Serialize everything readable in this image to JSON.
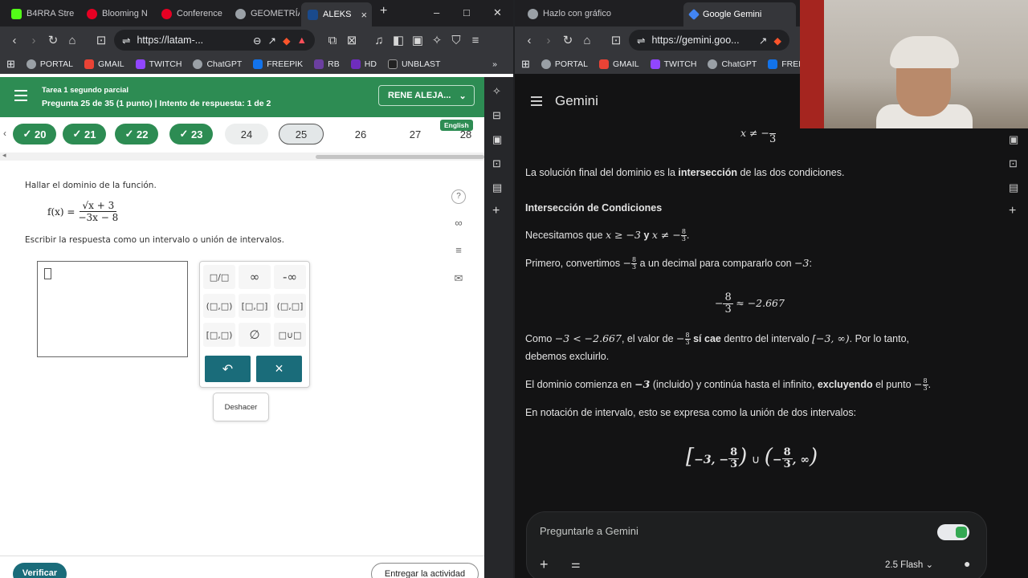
{
  "left_browser": {
    "tabs": [
      {
        "label": "B4RRA Stre",
        "color": "#53fc18"
      },
      {
        "label": "Blooming N",
        "color": "#e60023"
      },
      {
        "label": "Conference",
        "color": "#e60023"
      },
      {
        "label": "GEOMETRÍA",
        "color": "#9aa0a6"
      },
      {
        "label": "ALEKS",
        "color": "#1a4a8c"
      }
    ],
    "url": "https://latam-...",
    "bookmarks": [
      {
        "label": "PORTAL",
        "color": "#9aa0a6"
      },
      {
        "label": "GMAIL",
        "color": "#ea4335"
      },
      {
        "label": "TWITCH",
        "color": "#9146ff"
      },
      {
        "label": "ChatGPT",
        "color": "#9aa0a6"
      },
      {
        "label": "FREEPIK",
        "color": "#1273eb"
      },
      {
        "label": "RB",
        "color": "#6b3fa0"
      },
      {
        "label": "HD",
        "color": "#6f2dbd"
      },
      {
        "label": "UNBLAST",
        "color": "#222222"
      }
    ]
  },
  "aleks": {
    "task_title": "Tarea 1 segundo parcial",
    "progress": "Pregunta 25 de 35 (1 punto)  |  Intento de respuesta: 1 de 2",
    "user": "RENE ALEJA...",
    "english": "English",
    "questions": [
      {
        "label": "20",
        "done": true
      },
      {
        "label": "21",
        "done": true
      },
      {
        "label": "22",
        "done": true
      },
      {
        "label": "23",
        "done": true
      },
      {
        "label": "24",
        "done": false
      },
      {
        "label": "25",
        "done": false
      },
      {
        "label": "26",
        "done": false
      },
      {
        "label": "27",
        "done": false
      },
      {
        "label": "28",
        "done": false
      }
    ],
    "check": "✓",
    "question_text": "Hallar el dominio de la función.",
    "formula_lhs": "f(x) =",
    "formula_num": "√x + 3",
    "formula_den": "−3x − 8",
    "instruction": "Escribir la respuesta como un intervalo o unión de intervalos.",
    "keys": [
      "□/□",
      "∞",
      "-∞",
      "(□,□)",
      "[□,□]",
      "(□,□]",
      "[□,□)",
      "∅",
      "□∪□"
    ],
    "undo_symbol": "↶",
    "clear_symbol": "×",
    "tooltip": "Deshacer",
    "verify": "Verificar",
    "submit": "Entregar la actividad",
    "side_icons": [
      "?",
      "∞",
      "≡",
      "✉"
    ]
  },
  "right_browser": {
    "tabs": [
      {
        "label": "Hazlo con gráfico",
        "color": "#9aa0a6"
      },
      {
        "label": "Google Gemini",
        "color": "#4285f4"
      }
    ],
    "url": "https://gemini.goo...",
    "bookmarks": [
      {
        "label": "PORTAL",
        "color": "#9aa0a6"
      },
      {
        "label": "GMAIL",
        "color": "#ea4335"
      },
      {
        "label": "TWITCH",
        "color": "#9146ff"
      },
      {
        "label": "ChatGPT",
        "color": "#9aa0a6"
      },
      {
        "label": "FREE",
        "color": "#1273eb"
      }
    ]
  },
  "gemini": {
    "title": "Gemini",
    "top_formula": "x ≠ −",
    "top_frac_den": "3",
    "p1_a": "La solución final del dominio es la ",
    "p1_b": "intersección",
    "p1_c": " de las dos condiciones.",
    "heading": "Intersección de Condiciones",
    "p2_a": "Necesitamos que ",
    "p2_m1": "x ≥ −3",
    "p2_b": " y ",
    "p2_m2": "x ≠ −",
    "p3_a": "Primero, convertimos ",
    "p3_b": " a un decimal para compararlo con ",
    "p3_m": "−3",
    "approx": "≈ −2.667",
    "p4_a": "Como ",
    "p4_m1": "−3 < −2.667",
    "p4_b": ", el valor de ",
    "p4_c": "sí cae",
    "p4_d": " dentro del intervalo ",
    "p4_m2": "[−3, ∞)",
    "p4_e": ". Por lo tanto,",
    "p4_f": "debemos excluirlo.",
    "p5_a": "El dominio comienza en ",
    "p5_b": "−3",
    "p5_c": " (incluido) y continúa hasta el infinito, ",
    "p5_d": "excluyendo",
    "p5_e": " el punto ",
    "p6": "En notación de intervalo, esto se expresa como la unión de dos intervalos:",
    "frac_num": "8",
    "frac_den": "3",
    "input_placeholder": "Preguntarle a Gemini",
    "model": "2.5 Flash"
  }
}
